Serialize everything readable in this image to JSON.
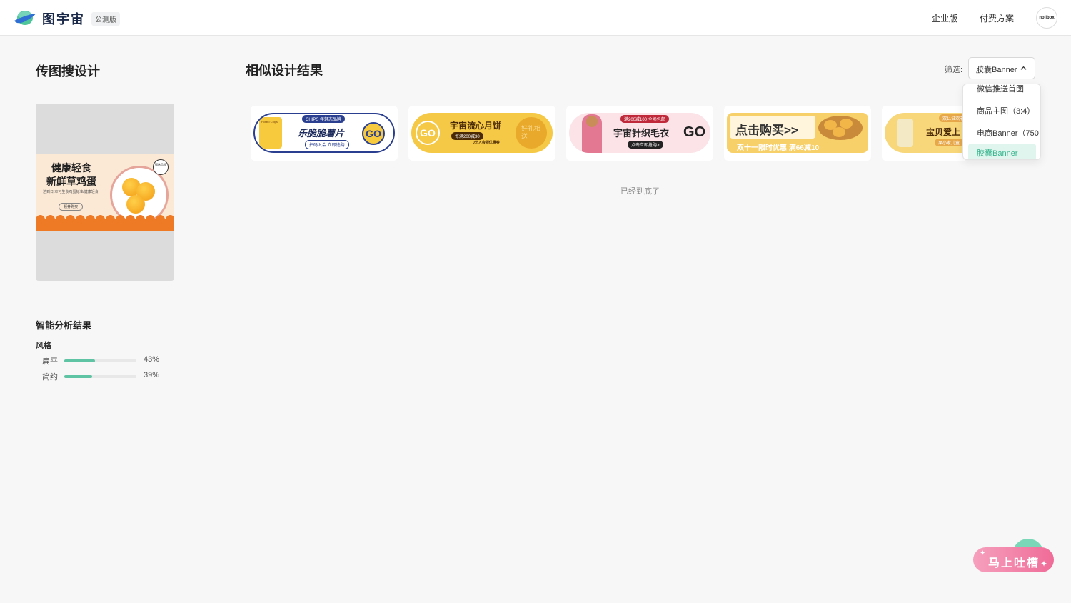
{
  "header": {
    "brand": "图宇宙",
    "beta_badge": "公测版",
    "nav": {
      "enterprise": "企业版",
      "pricing": "付费方案"
    },
    "avatar_text": "nolibox"
  },
  "left_panel": {
    "title": "传图搜设计",
    "uploaded_design": {
      "line1": "健康轻食",
      "line2": "新鲜草鸡蛋",
      "subtext": "达到日 本可生食鸡蛋标准/健康轻食",
      "button": "领券购买",
      "badge": "甄选品质"
    },
    "analysis": {
      "title": "智能分析结果",
      "group_label": "风格",
      "metrics": [
        {
          "name": "扁平",
          "value": 43,
          "label": "43%"
        },
        {
          "name": "简约",
          "value": 39,
          "label": "39%"
        }
      ]
    }
  },
  "results": {
    "title": "相似设计结果",
    "filter": {
      "label": "筛选:",
      "selected": "胶囊Banner",
      "options": [
        "微信推送首图",
        "商品主图（3:4）",
        "电商Banner（750",
        "胶囊Banner"
      ]
    },
    "cards": [
      {
        "title": "乐脆脆薯片",
        "tag": "CHIPS 年轻态品牌",
        "sub": "扫码入会 立即选购",
        "go": "GO",
        "bag": "Potato Chips"
      },
      {
        "title": "宇宙流心月饼",
        "sub1": "每满200减30",
        "sub2": "0元入会领优惠券",
        "go": "GO",
        "seal": "好礼相送"
      },
      {
        "title": "宇宙针织毛衣",
        "tag": "满200减100 全场包邮",
        "sub": "点击立即抢购>",
        "go": "GO"
      },
      {
        "title": "点击购买>>",
        "sub": "双十一限时优惠 满66减10"
      },
      {
        "title": "宝贝爱上",
        "tag": "双11狂欢节",
        "sub": "果小家儿童"
      }
    ],
    "end_text": "已经到底了"
  },
  "feedback": {
    "label": "马上吐槽"
  },
  "colors": {
    "accent": "#35b48c",
    "bar": "#5fc4a4",
    "feedback": "#ef6c98"
  }
}
